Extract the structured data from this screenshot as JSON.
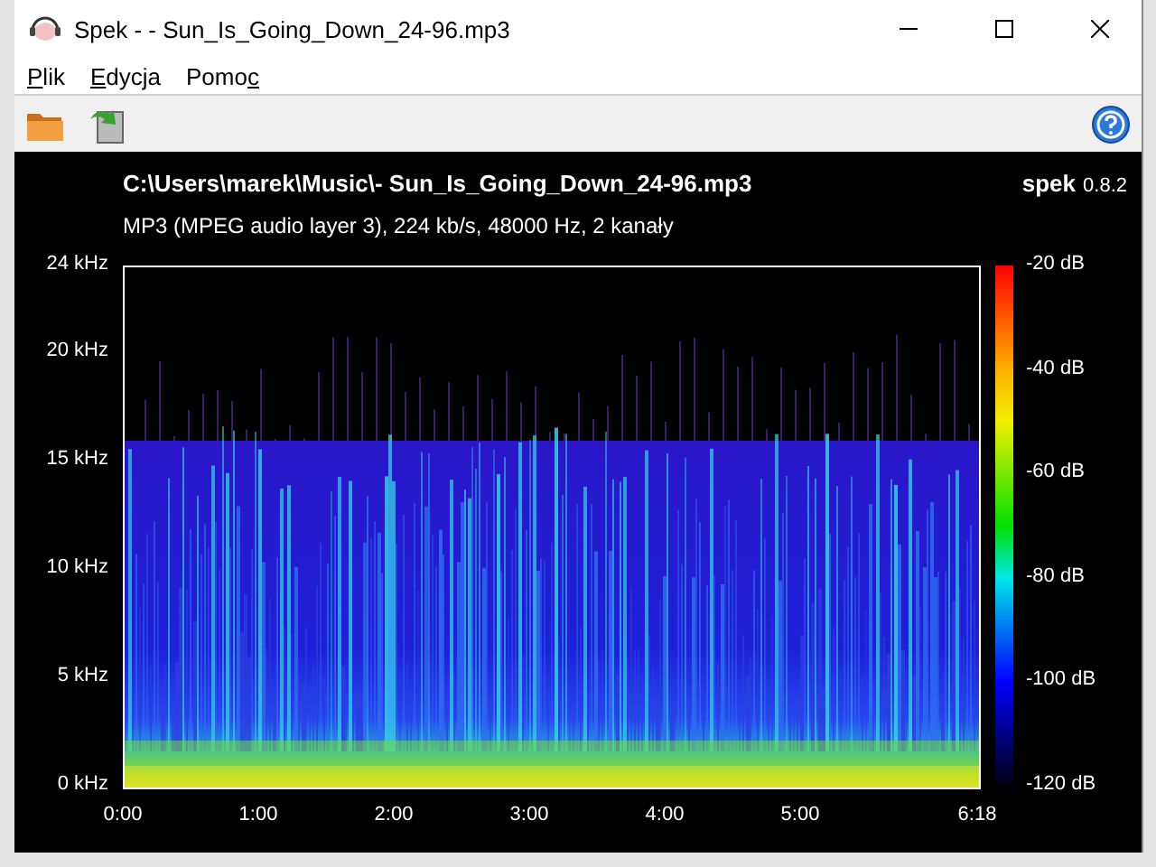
{
  "window": {
    "title": "Spek - - Sun_Is_Going_Down_24-96.mp3"
  },
  "menu": [
    {
      "label": "Plik",
      "accelerator_at_end": false
    },
    {
      "label": "Edycja",
      "accelerator_at_end": false
    },
    {
      "label": "Pomoc",
      "accelerator_at_end": true
    }
  ],
  "header": {
    "path": "C:\\Users\\marek\\Music\\- Sun_Is_Going_Down_24-96.mp3",
    "app_name": "spek",
    "version": "0.8.2",
    "info": "MP3 (MPEG audio layer 3), 224 kb/s, 48000 Hz, 2 kanały"
  },
  "frequency_axis": [
    "24 kHz",
    "20 kHz",
    "15 kHz",
    "10 kHz",
    "5 kHz",
    "0 kHz"
  ],
  "time_axis": [
    "0:00",
    "1:00",
    "2:00",
    "3:00",
    "4:00",
    "5:00",
    "6:18"
  ],
  "level_scale": [
    "-20 dB",
    "-40 dB",
    "-60 dB",
    "-80 dB",
    "-100 dB",
    "-120 dB"
  ]
}
